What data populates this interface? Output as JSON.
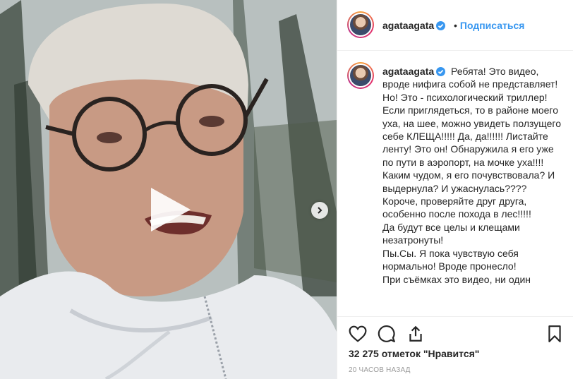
{
  "post": {
    "username": "agataagata",
    "follow_label": "Подписаться",
    "follow_separator": "•",
    "caption_text": "Ребята! Это видео, вроде нифига собой не представляет! Но! Это - психологический триллер! Если приглядеться, то в районе моего уха, на шее, можно увидеть ползущего себе КЛЕЩА!!!!! Да, да!!!!!! Листайте ленту! Это он! Обнаружила я его уже по пути в аэропорт, на мочке уха!!!!\nКаким чудом, я его почувствовала? И выдернула? И ужаснулась????\nКороче, проверяйте друг друга, особенно после похода в лес!!!!!\nДа будут все целы и клещами незатронуты!\nПы.Сы. Я пока чувствую себя нормально! Вроде пронесло!\nПри съёмках это видео, ни один",
    "likes_text": "32 275 отметок \"Нравится\"",
    "time_text": "20 часов назад"
  },
  "icons": {
    "verified": "verified-badge-icon",
    "play": "play-icon",
    "next": "chevron-right-icon",
    "like": "heart-icon",
    "comment": "comment-icon",
    "share": "share-icon",
    "save": "bookmark-icon"
  },
  "colors": {
    "accent_blue": "#3897f0",
    "text": "#262626",
    "muted": "#999999",
    "border": "#efefef"
  }
}
